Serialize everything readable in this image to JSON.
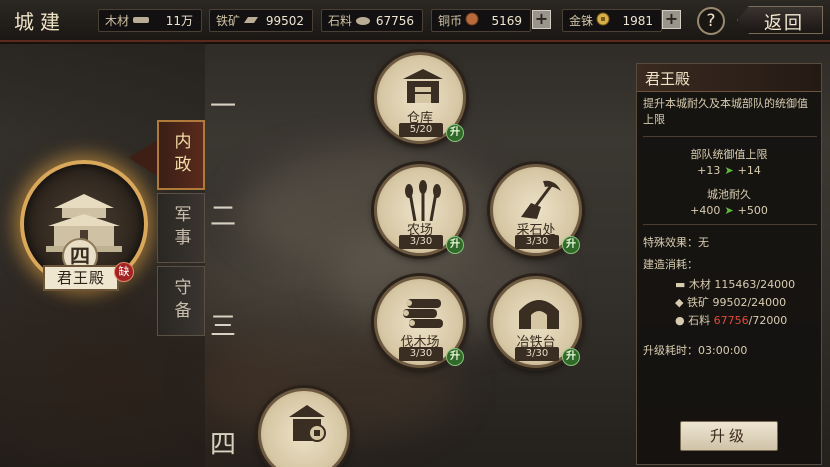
{
  "header": {
    "title": "城建",
    "back_label": "返回",
    "help_label": "?"
  },
  "resources": [
    {
      "name": "木材",
      "value": "11万",
      "icon": "wood-icon"
    },
    {
      "name": "铁矿",
      "value": "99502",
      "icon": "iron-icon"
    },
    {
      "name": "石料",
      "value": "67756",
      "icon": "stone-icon"
    },
    {
      "name": "铜币",
      "value": "5169",
      "icon": "copper-coin-icon"
    },
    {
      "name": "金铢",
      "value": "1981",
      "icon": "gold-coin-icon"
    }
  ],
  "keep": {
    "name": "君王殿",
    "level": "四",
    "badge": "缺"
  },
  "tabs": [
    {
      "label": "内政",
      "active": true
    },
    {
      "label": "军事",
      "active": false
    },
    {
      "label": "守备",
      "active": false
    }
  ],
  "tiers": [
    "一",
    "二",
    "三",
    "四"
  ],
  "buildings": [
    {
      "name": "仓库",
      "level": "5/20",
      "upgrade": "升",
      "icon": "warehouse-icon"
    },
    {
      "name": "农场",
      "level": "3/30",
      "upgrade": "升",
      "icon": "wheat-icon"
    },
    {
      "name": "采石处",
      "level": "3/30",
      "upgrade": "升",
      "icon": "pickaxe-icon"
    },
    {
      "name": "伐木场",
      "level": "3/30",
      "upgrade": "升",
      "icon": "logs-icon"
    },
    {
      "name": "冶铁台",
      "level": "3/30",
      "upgrade": "升",
      "icon": "furnace-icon"
    },
    {
      "name": "",
      "level": "",
      "upgrade": "",
      "icon": "mint-icon"
    }
  ],
  "panel": {
    "title": "君王殿",
    "desc": "提升本城耐久及本城部队的统御值上限",
    "stat1_label": "部队统御值上限",
    "stat1_from": "+13",
    "stat1_to": "+14",
    "stat2_label": "城池耐久",
    "stat2_from": "+400",
    "stat2_to": "+500",
    "special": "特殊效果：无",
    "cost_label": "建造消耗：",
    "costs": [
      {
        "name": "木材",
        "have": "115463",
        "need": "/24000",
        "short": false
      },
      {
        "name": "铁矿",
        "have": "99502",
        "need": "/24000",
        "short": false
      },
      {
        "name": "石料",
        "have": "67756",
        "need": "/72000",
        "short": true
      }
    ],
    "time": "升级耗时：03:00:00",
    "upgrade_label": "升级"
  },
  "colors": {
    "accent": "#d9a85a",
    "upgrade_green": "#2f6a2a",
    "shortage_red": "#e04a3a"
  }
}
